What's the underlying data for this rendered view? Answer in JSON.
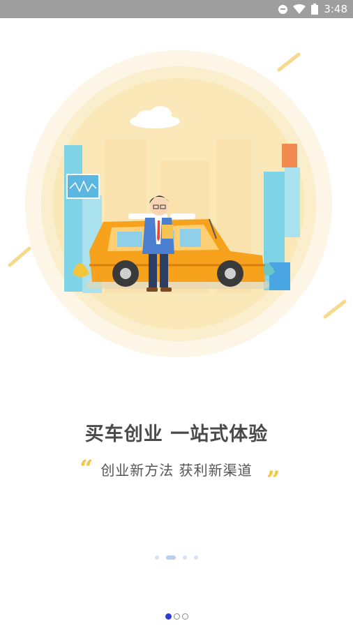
{
  "status_bar": {
    "time": "3:48",
    "icons": [
      "do-not-disturb-icon",
      "wifi-icon",
      "battery-icon"
    ]
  },
  "onboarding": {
    "title": "买车创业 一站式体验",
    "subtitle": "创业新方法 获利新渠道",
    "quote_open": "“",
    "quote_close": "”",
    "carousel": {
      "count": 4,
      "active_index": 1
    },
    "pager": {
      "count": 3,
      "active_index": 0
    }
  },
  "colors": {
    "status_bar_bg": "#9e9e9e",
    "accent_yellow": "#f5c542",
    "car_orange": "#f6a21c",
    "title_text": "#4a4a4a",
    "pager_active": "#2b3fd6"
  }
}
